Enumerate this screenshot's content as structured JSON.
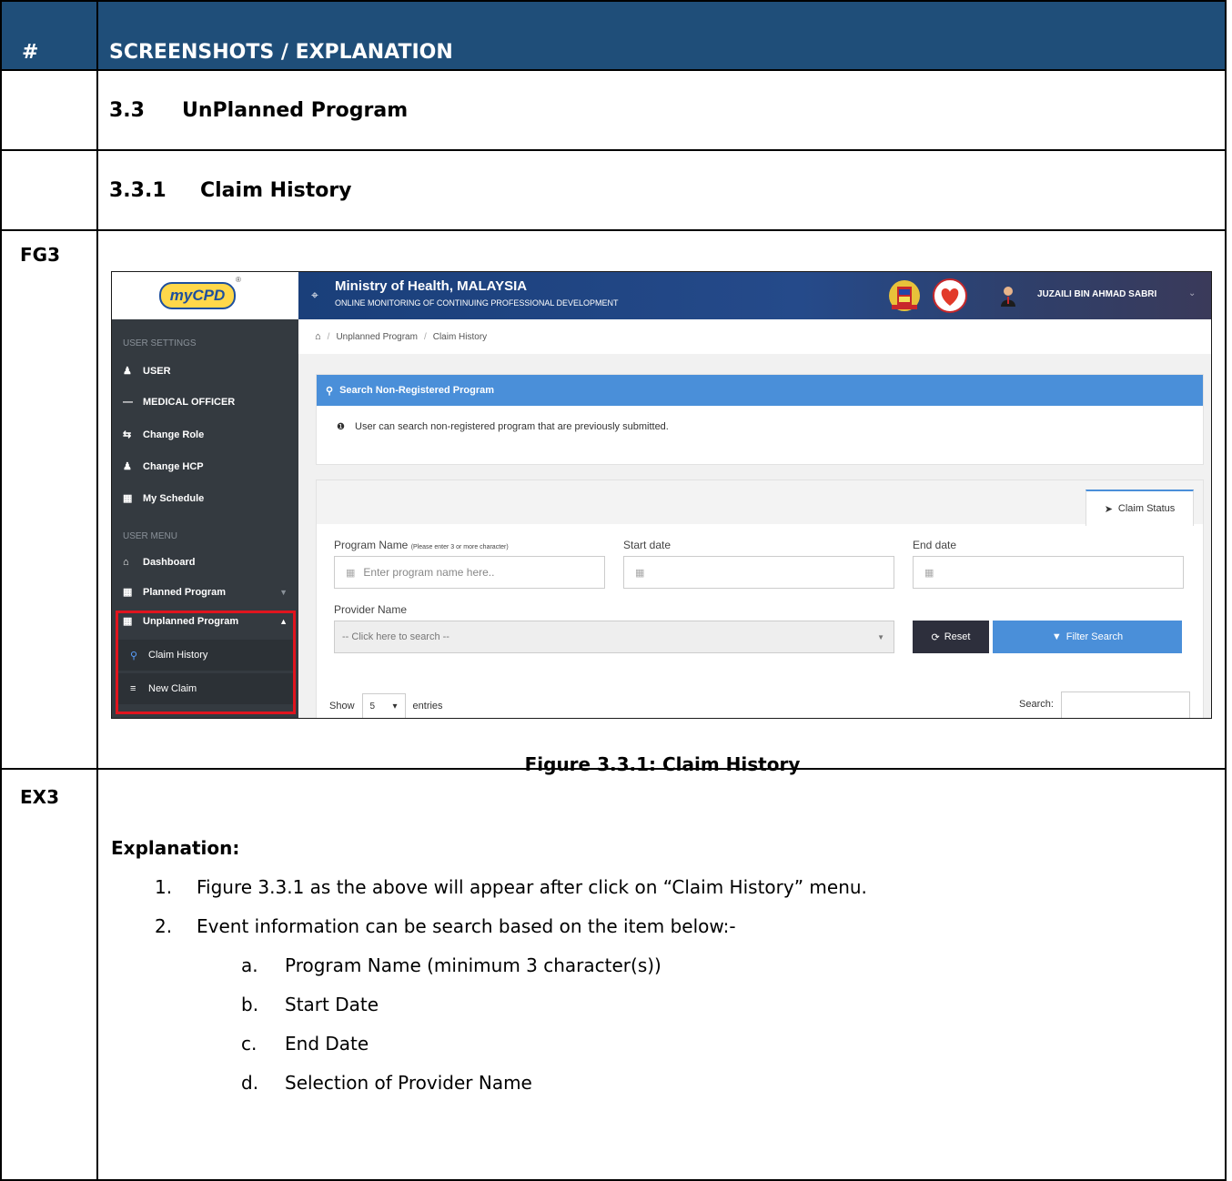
{
  "table_header": {
    "num": "#",
    "title": "SCREENSHOTS / EXPLANATION"
  },
  "section": {
    "num": "3.3",
    "title": "UnPlanned Program"
  },
  "subsection": {
    "num": "3.3.1",
    "title": "Claim History"
  },
  "figure_row_label": "FG3",
  "explanation_row_label": "EX3",
  "screenshot": {
    "logo_text": "myCPD",
    "logo_reg": "®",
    "header": {
      "title": "Ministry of Health, MALAYSIA",
      "subtitle": "ONLINE MONITORING OF CONTINUING PROFESSIONAL DEVELOPMENT",
      "username": "JUZAILI BIN AHMAD SABRI"
    },
    "sidebar": {
      "section_user_settings": "USER SETTINGS",
      "user": "USER",
      "medical_officer": "MEDICAL OFFICER",
      "change_role": "Change Role",
      "change_hcp": "Change HCP",
      "my_schedule": "My Schedule",
      "section_user_menu": "USER MENU",
      "dashboard": "Dashboard",
      "planned_program": "Planned Program",
      "unplanned_program": "Unplanned Program",
      "claim_history": "Claim History",
      "new_claim": "New Claim"
    },
    "breadcrumb": {
      "level1": "Unplanned Program",
      "level2": "Claim History"
    },
    "search_panel": {
      "title": "Search Non-Registered Program",
      "info": "User can search non-registered program that are previously submitted."
    },
    "form": {
      "tab_label": "Claim Status",
      "program_name_label": "Program Name",
      "program_name_hint": "(Please enter 3 or more character)",
      "program_name_placeholder": "Enter program name here..",
      "start_date_label": "Start date",
      "end_date_label": "End date",
      "provider_label": "Provider Name",
      "provider_placeholder": "-- Click here to search --",
      "reset_label": "Reset",
      "filter_label": "Filter Search",
      "show_label": "Show",
      "entries_value": "5",
      "entries_label": "entries",
      "search_label": "Search:"
    },
    "colors": {
      "accent": "#4a8fd9",
      "sidebar": "#343a40",
      "highlight": "#e0141e"
    }
  },
  "caption": "Figure 3.3.1: Claim History",
  "explanation": {
    "title": "Explanation:",
    "items": [
      {
        "marker": "1.",
        "text": "Figure 3.3.1 as the above will appear after click on “Claim History” menu."
      },
      {
        "marker": "2.",
        "text": "Event information can be search based on the item below:-"
      }
    ],
    "subitems": [
      {
        "marker": "a.",
        "text": "Program Name (minimum 3 character(s))"
      },
      {
        "marker": "b.",
        "text": "Start Date"
      },
      {
        "marker": "c.",
        "text": "End Date"
      },
      {
        "marker": "d.",
        "text": "Selection of Provider Name"
      }
    ]
  }
}
